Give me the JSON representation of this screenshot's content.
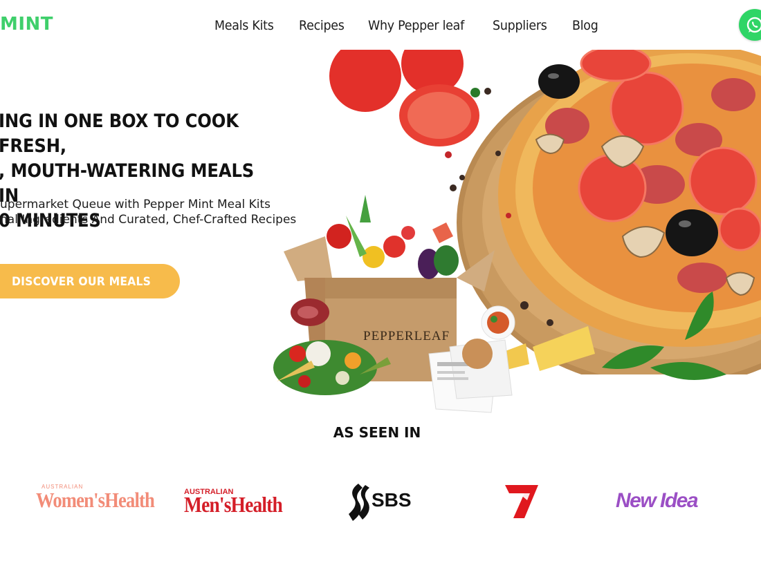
{
  "header": {
    "logo": "MINT",
    "nav": [
      "Meals Kits",
      "Recipes",
      "Why Pepper leaf",
      "Suppliers",
      "Blog"
    ]
  },
  "hero": {
    "headline_lines": [
      "ING IN ONE BOX TO COOK FRESH,",
      ", MOUTH-WATERING MEALS IN",
      "0 MINUTES"
    ],
    "sub_lines": [
      "upermarket Queue with Pepper Mint Meal Kits",
      "nal Ingredients And Curated, Chef-Crafted Recipes"
    ],
    "cta": "DISCOVER OUR MEALS KITS",
    "box_text": "PEPPERLEAF"
  },
  "seen": {
    "title": "AS SEEN IN",
    "logos": {
      "womens_health_small": "AUSTRALIAN",
      "womens_health": "Women'sHealth",
      "mens_health_small": "AUSTRALIAN",
      "mens_health": "Men'sHealth",
      "sbs": "SBS",
      "new_idea": "New Idea"
    }
  },
  "colors": {
    "brand_green": "#3fcf6b",
    "cta": "#f7bb4b",
    "womens_health": "#f28c78",
    "mens_health": "#d41e28",
    "seven": "#e0181e",
    "new_idea": "#9b4fc5"
  }
}
